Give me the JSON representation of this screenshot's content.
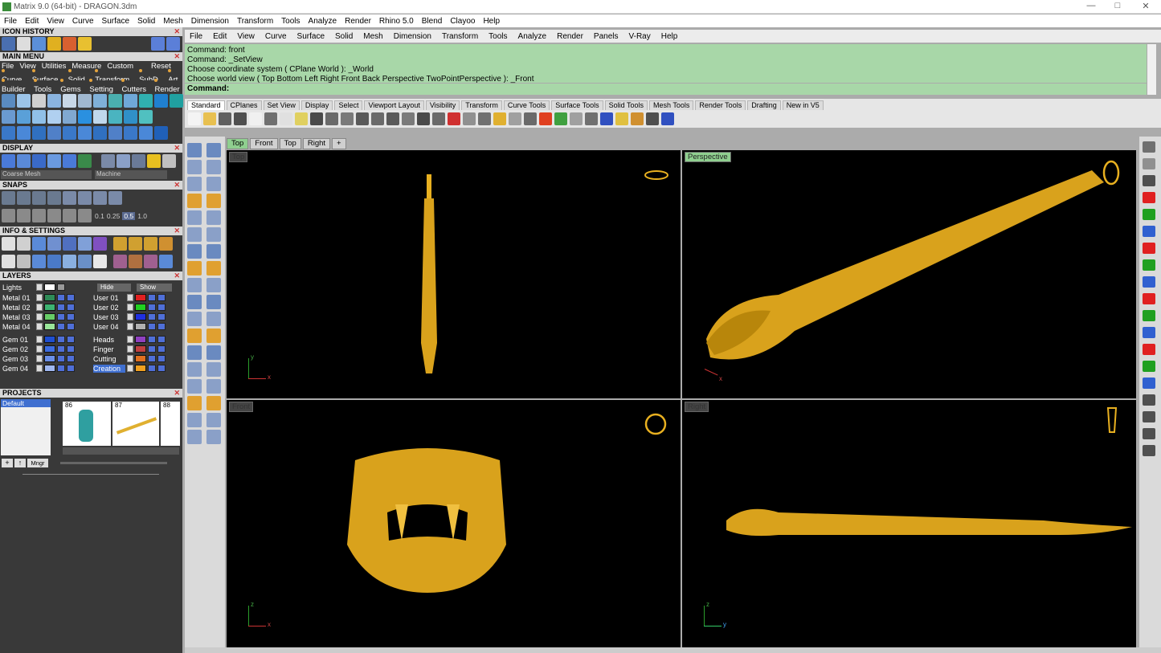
{
  "window": {
    "title": "Matrix 9.0 (64-bit) - DRAGON.3dm"
  },
  "top_menu": [
    "File",
    "Edit",
    "View",
    "Curve",
    "Surface",
    "Solid",
    "Mesh",
    "Dimension",
    "Transform",
    "Tools",
    "Analyze",
    "Render",
    "Rhino 5.0",
    "Blend",
    "Clayoo",
    "Help"
  ],
  "left_panel": {
    "icon_history": "ICON HISTORY",
    "main_menu": "MAIN MENU",
    "main_menu_row1": [
      "File",
      "View",
      "Utilities",
      "Measure",
      "Custom"
    ],
    "reset": "Reset",
    "main_menu_row2": [
      "Curve",
      "Surface",
      "Solid",
      "Transform",
      "SubD",
      "Art"
    ],
    "main_menu_row3": [
      "Builder",
      "Tools",
      "Gems",
      "Setting",
      "Cutters",
      "Render"
    ],
    "display": "DISPLAY",
    "display_mode": "Coarse Mesh",
    "display_material": "Machine",
    "snaps": "SNAPS",
    "snap_values": [
      "0.1",
      "0.25",
      "0.5",
      "1.0"
    ],
    "info_settings": "INFO & SETTINGS",
    "layers": "LAYERS",
    "lights": "Lights",
    "hide": "Hide",
    "show": "Show",
    "layers_left": [
      {
        "name": "Metal 01",
        "color": "#2e8b57"
      },
      {
        "name": "Metal 02",
        "color": "#3cb371"
      },
      {
        "name": "Metal 03",
        "color": "#66cc66"
      },
      {
        "name": "Metal 04",
        "color": "#99e699"
      },
      {
        "name": "Gem 01",
        "color": "#1f4fd0"
      },
      {
        "name": "Gem 02",
        "color": "#3d6de0"
      },
      {
        "name": "Gem 03",
        "color": "#6a8fe8"
      },
      {
        "name": "Gem 04",
        "color": "#9fb7f0"
      }
    ],
    "layers_right": [
      {
        "name": "User 01",
        "color": "#e02020"
      },
      {
        "name": "User 02",
        "color": "#20d020"
      },
      {
        "name": "User 03",
        "color": "#2030e0"
      },
      {
        "name": "User 04",
        "color": "#b0b0b0"
      },
      {
        "name": "Heads",
        "color": "#9040c0"
      },
      {
        "name": "Finger",
        "color": "#c04040"
      },
      {
        "name": "Cutting",
        "color": "#e07020"
      },
      {
        "name": "Creation",
        "color": "#f0a020"
      }
    ],
    "projects": "PROJECTS",
    "project_default": "Default",
    "thumb_numbers": [
      "86",
      "87",
      "88"
    ],
    "mngr": "Mngr"
  },
  "main_menu_bar": [
    "File",
    "Edit",
    "View",
    "Curve",
    "Surface",
    "Solid",
    "Mesh",
    "Dimension",
    "Transform",
    "Tools",
    "Analyze",
    "Render",
    "Panels",
    "V-Ray",
    "Help"
  ],
  "command_history": [
    "Command: front",
    "Command: _SetView",
    "Choose coordinate system ( CPlane  World ): _World",
    "Choose world view ( Top  Bottom  Left  Right  Front  Back  Perspective  TwoPointPerspective ): _Front"
  ],
  "command_prompt": "Command:",
  "toolbar_tabs": [
    "Standard",
    "CPlanes",
    "Set View",
    "Display",
    "Select",
    "Viewport Layout",
    "Visibility",
    "Transform",
    "Curve Tools",
    "Surface Tools",
    "Solid Tools",
    "Mesh Tools",
    "Render Tools",
    "Drafting",
    "New in V5"
  ],
  "viewport_tabs": [
    "Top",
    "Front",
    "Top",
    "Right",
    "+"
  ],
  "viewports": [
    {
      "label": "Top",
      "axis_v": "y",
      "axis_h": "x"
    },
    {
      "label": "Perspective",
      "axis_v": "",
      "axis_h": "x"
    },
    {
      "label": "Front",
      "axis_v": "z",
      "axis_h": "x"
    },
    {
      "label": "Right",
      "axis_v": "z",
      "axis_h": "y"
    }
  ],
  "colors": {
    "accent": "#8fcf8f",
    "command_bg": "#a8d7a8",
    "gold": "#e8b020",
    "panel_bg": "#393939"
  }
}
